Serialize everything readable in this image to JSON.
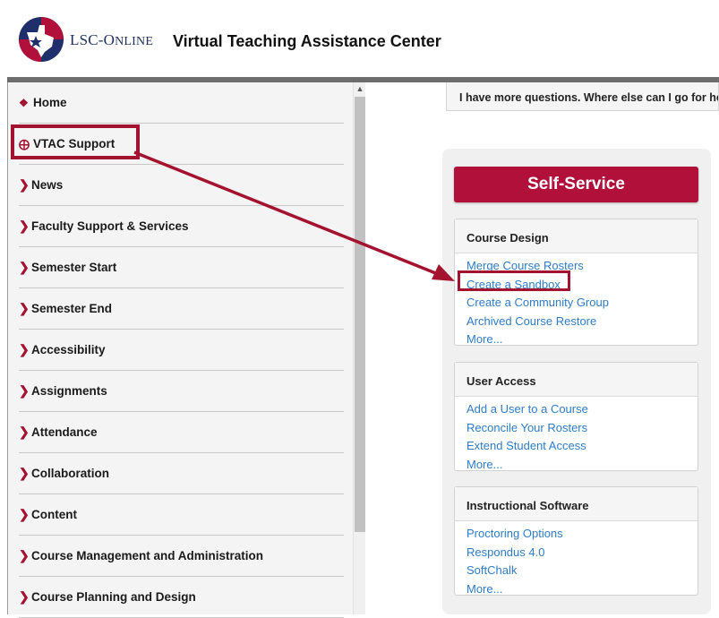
{
  "header": {
    "logo_text_main": "LSC-O",
    "logo_text_small": "NLINE",
    "site_title": "Virtual Teaching Assistance Center"
  },
  "sidebar": {
    "items": [
      {
        "label": "Home",
        "icon": "home-icon"
      },
      {
        "label": "VTAC Support",
        "icon": "lifebuoy-icon"
      },
      {
        "label": "News",
        "icon": "chevron-right-icon"
      },
      {
        "label": "Faculty Support & Services",
        "icon": "chevron-right-icon"
      },
      {
        "label": "Semester Start",
        "icon": "chevron-right-icon"
      },
      {
        "label": "Semester End",
        "icon": "chevron-right-icon"
      },
      {
        "label": "Accessibility",
        "icon": "chevron-right-icon"
      },
      {
        "label": "Assignments",
        "icon": "chevron-right-icon"
      },
      {
        "label": "Attendance",
        "icon": "chevron-right-icon"
      },
      {
        "label": "Collaboration",
        "icon": "chevron-right-icon"
      },
      {
        "label": "Content",
        "icon": "chevron-right-icon"
      },
      {
        "label": "Course Management and Administration",
        "icon": "chevron-right-icon"
      },
      {
        "label": "Course Planning and Design",
        "icon": "chevron-right-icon"
      }
    ]
  },
  "main": {
    "question": "I have more questions. Where else can I go for help?",
    "self_service_label": "Self-Service",
    "cards": [
      {
        "title": "Course Design",
        "links": [
          "Merge Course Rosters",
          "Create a Sandbox",
          "Create a Community Group",
          "Archived Course Restore",
          "More..."
        ]
      },
      {
        "title": "User Access",
        "links": [
          "Add a User to a Course",
          "Reconcile Your Rosters",
          "Extend Student Access",
          "More..."
        ]
      },
      {
        "title": "Instructional Software",
        "links": [
          "Proctoring Options",
          "Respondus 4.0",
          "SoftChalk",
          "More..."
        ]
      }
    ]
  },
  "colors": {
    "accent": "#a3122f",
    "button": "#b0103a",
    "link": "#2e7bc4"
  }
}
